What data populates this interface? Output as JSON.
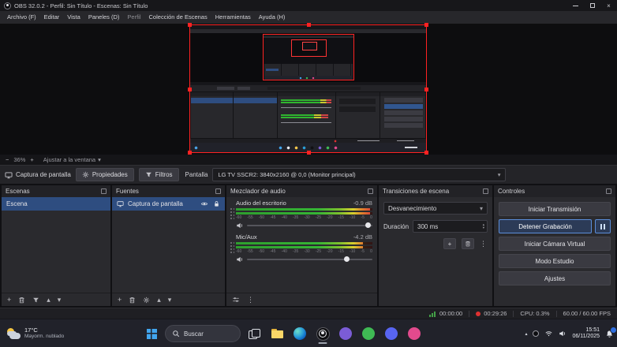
{
  "icons": {
    "minimize": "–",
    "close": "×",
    "plus": "+",
    "minus": "−",
    "dots_vertical": "⋮",
    "chevron_up": "▴",
    "chevron_down": "▾",
    "tray_chevron": "▴"
  },
  "titlebar": {
    "title": "OBS 32.0.2 - Perfil: Sin Título - Escenas: Sin Título"
  },
  "menubar": {
    "items": [
      "Archivo (F)",
      "Editar",
      "Vista",
      "Paneles (D)",
      "Perfil",
      "Colección de Escenas",
      "Herramientas",
      "Ayuda (H)"
    ]
  },
  "preview": {
    "zoom_value": "36%",
    "fit_label": "Ajustar a la ventana"
  },
  "source_toolbar": {
    "source_name": "Captura de pantalla",
    "properties": "Propiedades",
    "filters": "Filtros",
    "screen_label": "Pantalla",
    "screen_value": "LG TV SSCR2: 3840x2160 @ 0,0 (Monitor principal)"
  },
  "scenes": {
    "title": "Escenas",
    "items": [
      {
        "name": "Escena"
      }
    ]
  },
  "sources": {
    "title": "Fuentes",
    "items": [
      {
        "name": "Captura de pantalla"
      }
    ]
  },
  "mixer": {
    "title": "Mezclador de audio",
    "scale": [
      "-60",
      "-55",
      "-50",
      "-45",
      "-40",
      "-35",
      "-30",
      "-25",
      "-20",
      "-15",
      "-10",
      "-5",
      "0"
    ],
    "channels": [
      {
        "name": "Audio del escritorio",
        "db": "-0.9 dB",
        "meter_pct": 98,
        "meter_rest_pct": 2,
        "slider_pct": 97
      },
      {
        "name": "Mic/Aux",
        "db": "-4.2 dB",
        "meter_pct": 93,
        "meter_rest_pct": 7,
        "slider_pct": 80
      }
    ]
  },
  "transitions": {
    "title": "Transiciones de escena",
    "current": "Desvanecimiento",
    "duration_label": "Duración",
    "duration_value": "300 ms"
  },
  "controls": {
    "title": "Controles",
    "start_streaming": "Iniciar Transmisión",
    "stop_recording": "Detener Grabación",
    "virtual_camera": "Iniciar Cámara Virtual",
    "studio_mode": "Modo Estudio",
    "settings": "Ajustes"
  },
  "statusbar": {
    "stream_time": "00:00:00",
    "recording_time": "00:29:26",
    "cpu": "CPU: 0.3%",
    "fps": "60.00 / 60.00 FPS"
  },
  "taskbar": {
    "weather_temp": "17°C",
    "weather_desc": "Mayorm. nublado",
    "search_placeholder": "Buscar",
    "clock_time": "15:51",
    "clock_date": "06/11/2025"
  },
  "colors": {
    "selection_blue": "#2e4d80",
    "accent_blue": "#5b8dd9",
    "record_red": "#e03131",
    "meter_green": "#35b535"
  }
}
